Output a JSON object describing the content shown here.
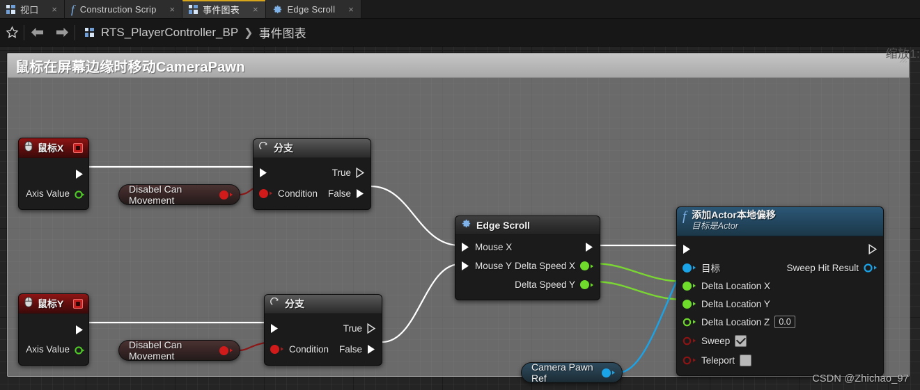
{
  "window": {
    "zoom_label": "缩放1:"
  },
  "tabs": [
    {
      "label": "视口",
      "icon": "blueprint-grid-icon",
      "active": false,
      "close": "×"
    },
    {
      "label": "Construction Scrip",
      "icon": "function-fx-icon",
      "active": false,
      "close": "×"
    },
    {
      "label": "事件图表",
      "icon": "blueprint-grid-icon",
      "active": true,
      "close": "×"
    },
    {
      "label": "Edge Scroll",
      "icon": "gear-icon",
      "active": false,
      "close": "×"
    }
  ],
  "breadcrumb": {
    "star": "☆",
    "back": "back-arrow",
    "forward": "forward-arrow",
    "root": "RTS_PlayerController_BP",
    "separator": "❯",
    "leaf": "事件图表"
  },
  "comment": {
    "title": "鼠标在屏幕边缘时移动CameraPawn"
  },
  "nodes": {
    "mouse_x": {
      "title": "鼠标X",
      "exec_out": "",
      "axis_value": "Axis Value"
    },
    "mouse_y": {
      "title": "鼠标Y",
      "exec_out": "",
      "axis_value": "Axis Value"
    },
    "branch_x": {
      "title": "分支",
      "condition": "Condition",
      "true": "True",
      "false": "False"
    },
    "branch_y": {
      "title": "分支",
      "condition": "Condition",
      "true": "True",
      "false": "False"
    },
    "disable_movement_x": {
      "label": "Disabel Can Movement"
    },
    "disable_movement_y": {
      "label": "Disabel Can Movement"
    },
    "edge_scroll": {
      "title": "Edge Scroll",
      "mouse_x": "Mouse X",
      "mouse_y": "Mouse Y",
      "delta_speed_x": "Delta Speed X",
      "delta_speed_y": "Delta Speed Y"
    },
    "camera_pawn_ref": {
      "label": "Camera Pawn Ref"
    },
    "add_actor_local_offset": {
      "title": "添加Actor本地偏移",
      "subtitle": "目标是Actor",
      "target": "目标",
      "sweep_hit_result": "Sweep Hit Result",
      "delta_location_x": "Delta Location X",
      "delta_location_y": "Delta Location Y",
      "delta_location_z": "Delta Location Z",
      "delta_location_z_value": "0.0",
      "sweep": "Sweep",
      "sweep_checked": true,
      "teleport": "Teleport",
      "teleport_checked": false
    }
  },
  "watermark": "CSDN @Zhichao_97",
  "colors": {
    "exec_wire": "#ffffff",
    "float_wire": "#7ad632",
    "object_wire": "#1ba3e8",
    "bool_pin": "#d11b1b",
    "event_header": "#8e1414",
    "function_header": "#2b5776",
    "tab_accent": "#d8a61b"
  }
}
